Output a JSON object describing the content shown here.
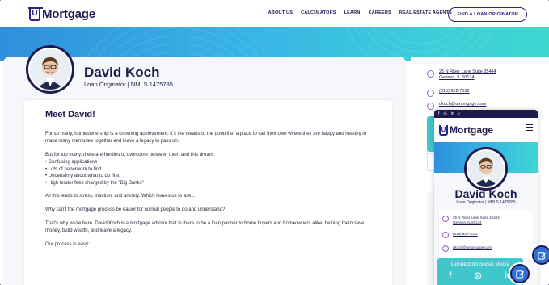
{
  "header": {
    "logo_letter": "U",
    "logo_text": "Mortgage",
    "nav": [
      "ABOUT US",
      "CALCULATORS",
      "LEARN",
      "CAREERS",
      "REAL ESTATE AGENTS"
    ],
    "cta": "FIND A LOAN ORIGINATOR"
  },
  "profile": {
    "name": "David Koch",
    "subtitle": "Loan Originator   |   NMLS 1475785"
  },
  "bio": {
    "title": "Meet David!",
    "p1": "For so many, homeownership is a crowning achievement. It's the means to the good life; a place to call their own where they are happy and healthy to make many memories together and leave a legacy to pass on.",
    "p2": "But for too many, there are hurdles to overcome between them and this dream:",
    "bullets": [
      "• Confusing applications",
      "• Lots of paperwork to find",
      "• Uncertainty about what to do first",
      "• High lender fees charged by the \"Big Banks\""
    ],
    "p3": "All this leads to stress, inaction, and anxiety. Which leaves us to ask...",
    "p4": "Why can't the mortgage process be easier for normal people to do and understand?",
    "p5": "That's why we're here. David Koch is a mortgage advisor that is there to be a loan partner to home buyers and homeowners alike, helping them save money, build wealth, and leave a legacy.",
    "p6": "Our process is easy:"
  },
  "contact": {
    "address_line1": "25 N River Lane Suite 25444",
    "address_line2": "Geneva, IL 60134",
    "phone": "(815) 922-7032",
    "email": "dkoch@umortgage.com"
  },
  "phone_preview": {
    "top_icons": [
      "f",
      "◎",
      "in",
      "♪"
    ],
    "logo_letter": "U",
    "logo_text": "Mortgage",
    "name": "David Koch",
    "subtitle": "Loan Originator  |  NMLS 1475785",
    "address_line1": "25 N River Lane Suite 25444",
    "address_line2": "Geneva, IL 60134",
    "phone": "(815) 922-7032",
    "email": "dkoch@umortgage.com",
    "social_title": "Connect on Social Media",
    "social_icons": [
      "f",
      "◎",
      "in"
    ]
  },
  "colors": {
    "navy": "#1d1a4e",
    "accent_blue": "#2f6fd6",
    "teal": "#3fc7cb",
    "purple_icon": "#9c5bd6"
  }
}
